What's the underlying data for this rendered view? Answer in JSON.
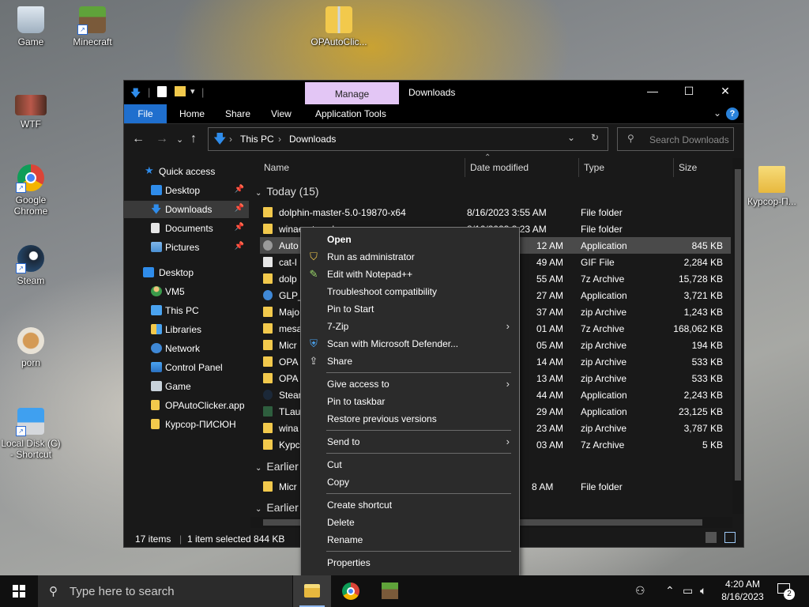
{
  "desktop": {
    "icons": [
      {
        "label": "Game"
      },
      {
        "label": "Minecraft"
      },
      {
        "label": "OPAutoClic..."
      },
      {
        "label": "WTF"
      },
      {
        "label": "Google Chrome"
      },
      {
        "label": "Steam"
      },
      {
        "label": "porn"
      },
      {
        "label": "Local Disk (C) - Shortcut"
      },
      {
        "label": "Курсор-П..."
      }
    ]
  },
  "window": {
    "title": "Downloads",
    "manage_tab": "Manage",
    "ribbon": {
      "file": "File",
      "home": "Home",
      "share": "Share",
      "view": "View",
      "app_tools": "Application Tools",
      "help": "?"
    },
    "controls": {
      "minimize": "—",
      "maximize": "☐",
      "close": "✕"
    },
    "address": {
      "root": "This PC",
      "current": "Downloads"
    },
    "search_placeholder": "Search Downloads",
    "columns": {
      "name": "Name",
      "date": "Date modified",
      "type": "Type",
      "size": "Size"
    },
    "nav": [
      {
        "label": "Quick access"
      },
      {
        "label": "Desktop"
      },
      {
        "label": "Downloads"
      },
      {
        "label": "Documents"
      },
      {
        "label": "Pictures"
      },
      {
        "label": "Desktop"
      },
      {
        "label": "VM5"
      },
      {
        "label": "This PC"
      },
      {
        "label": "Libraries"
      },
      {
        "label": "Network"
      },
      {
        "label": "Control Panel"
      },
      {
        "label": "Game"
      },
      {
        "label": "OPAutoClicker.app"
      },
      {
        "label": "Курсор-ПИСЮН"
      }
    ],
    "groups": {
      "today": "Today (15)",
      "earlier1": "Earlier",
      "earlier2": "Earlier"
    },
    "rows": [
      {
        "name": "dolphin-master-5.0-19870-x64",
        "date": "8/16/2023 3:55 AM",
        "type": "File folder",
        "size": ""
      },
      {
        "name": "winaerotweaker",
        "date": "8/16/2023 3:23 AM",
        "type": "File folder",
        "size": ""
      },
      {
        "name": "Auto",
        "date": "12 AM",
        "type": "Application",
        "size": "845 KB"
      },
      {
        "name": "cat-l",
        "date": "49 AM",
        "type": "GIF File",
        "size": "2,284 KB"
      },
      {
        "name": "dolp",
        "date": "55 AM",
        "type": "7z Archive",
        "size": "15,728 KB"
      },
      {
        "name": "GLP_",
        "date": "27 AM",
        "type": "Application",
        "size": "3,721 KB"
      },
      {
        "name": "Majo",
        "date": "37 AM",
        "type": "zip Archive",
        "size": "1,243 KB"
      },
      {
        "name": "mesa",
        "date": "01 AM",
        "type": "7z Archive",
        "size": "168,062 KB"
      },
      {
        "name": "Micr",
        "date": "05 AM",
        "type": "zip Archive",
        "size": "194 KB"
      },
      {
        "name": "OPA",
        "date": "14 AM",
        "type": "zip Archive",
        "size": "533 KB"
      },
      {
        "name": "OPA",
        "date": "13 AM",
        "type": "zip Archive",
        "size": "533 KB"
      },
      {
        "name": "Stean",
        "date": "44 AM",
        "type": "Application",
        "size": "2,243 KB"
      },
      {
        "name": "TLau",
        "date": "29 AM",
        "type": "Application",
        "size": "23,125 KB"
      },
      {
        "name": "wina",
        "date": "23 AM",
        "type": "zip Archive",
        "size": "3,787 KB"
      },
      {
        "name": "Kypc",
        "date": "03 AM",
        "type": "7z Archive",
        "size": "5 KB"
      },
      {
        "name": "Micr",
        "date": "8 AM",
        "type": "File folder",
        "size": ""
      }
    ],
    "status": {
      "items": "17 items",
      "selected": "1 item selected  844 KB"
    }
  },
  "context_menu": {
    "open": "Open",
    "run_admin": "Run as administrator",
    "edit_npp": "Edit with Notepad++",
    "troubleshoot": "Troubleshoot compatibility",
    "pin_start": "Pin to Start",
    "zip7": "7-Zip",
    "defender": "Scan with Microsoft Defender...",
    "share": "Share",
    "give_access": "Give access to",
    "pin_taskbar": "Pin to taskbar",
    "restore": "Restore previous versions",
    "send_to": "Send to",
    "cut": "Cut",
    "copy": "Copy",
    "create_shortcut": "Create shortcut",
    "delete": "Delete",
    "rename": "Rename",
    "properties": "Properties"
  },
  "taskbar": {
    "search_placeholder": "Type here to search",
    "time": "4:20 AM",
    "date": "8/16/2023",
    "notifications": "2"
  },
  "colors": {
    "accent": "#1f6fce",
    "manage": "#e3c6f5",
    "folder": "#f2c94c"
  }
}
